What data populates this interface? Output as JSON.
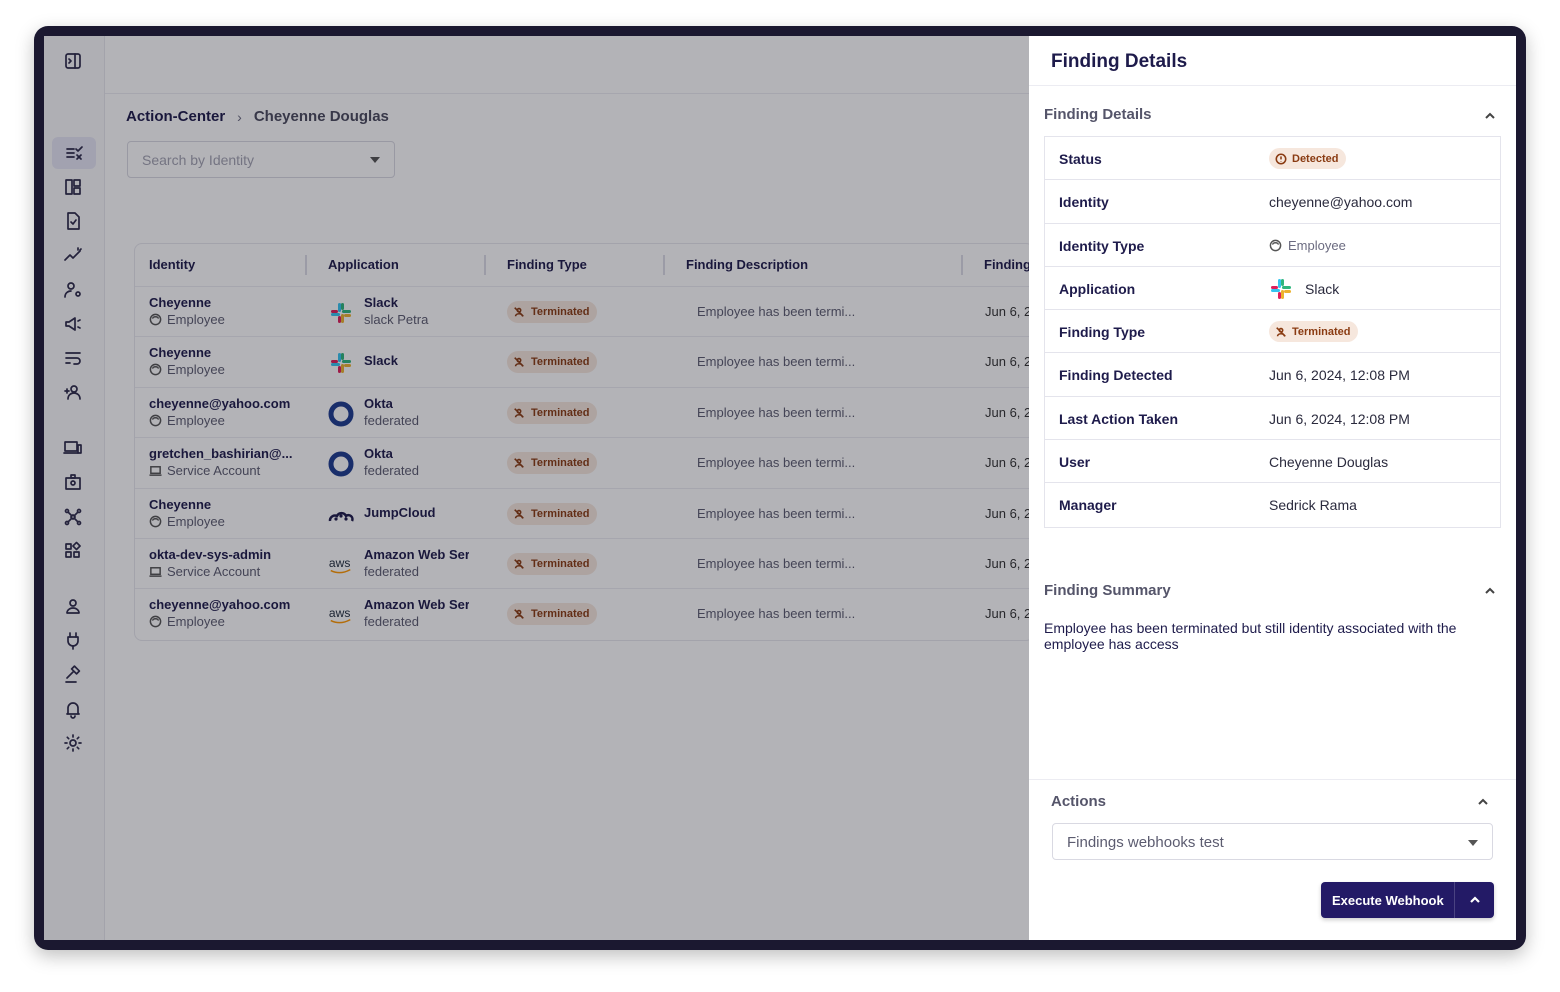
{
  "breadcrumb": {
    "root": "Action-Center",
    "current": "Cheyenne Douglas"
  },
  "search": {
    "placeholder": "Search by Identity"
  },
  "table": {
    "headers": [
      "Identity",
      "Application",
      "Finding Type",
      "Finding Description",
      "Finding"
    ],
    "rows": [
      {
        "identity": "Cheyenne",
        "identity_type": "Employee",
        "app": "Slack",
        "app_sub": "slack Petra",
        "finding_type": "Terminated",
        "description": "Employee has been termi...",
        "date": "Jun 6, 2"
      },
      {
        "identity": "Cheyenne",
        "identity_type": "Employee",
        "app": "Slack",
        "app_sub": "",
        "finding_type": "Terminated",
        "description": "Employee has been termi...",
        "date": "Jun 6, 2"
      },
      {
        "identity": "cheyenne@yahoo.com",
        "identity_type": "Employee",
        "app": "Okta",
        "app_sub": "federated",
        "finding_type": "Terminated",
        "description": "Employee has been termi...",
        "date": "Jun 6, 2"
      },
      {
        "identity": "gretchen_bashirian@...",
        "identity_type": "Service Account",
        "app": "Okta",
        "app_sub": "federated",
        "finding_type": "Terminated",
        "description": "Employee has been termi...",
        "date": "Jun 6, 2"
      },
      {
        "identity": "Cheyenne",
        "identity_type": "Employee",
        "app": "JumpCloud",
        "app_sub": "",
        "finding_type": "Terminated",
        "description": "Employee has been termi...",
        "date": "Jun 6, 2"
      },
      {
        "identity": "okta-dev-sys-admin",
        "identity_type": "Service Account",
        "app": "Amazon Web Ser",
        "app_sub": "federated",
        "finding_type": "Terminated",
        "description": "Employee has been termi...",
        "date": "Jun 6, 2"
      },
      {
        "identity": "cheyenne@yahoo.com",
        "identity_type": "Employee",
        "app": "Amazon Web Ser",
        "app_sub": "federated",
        "finding_type": "Terminated",
        "description": "Employee has been termi...",
        "date": "Jun 6, 2"
      }
    ]
  },
  "drawer": {
    "title": "Finding Details",
    "details_section": "Finding Details",
    "details": {
      "status_label": "Status",
      "status": "Detected",
      "identity_label": "Identity",
      "identity": "cheyenne@yahoo.com",
      "identity_type_label": "Identity Type",
      "identity_type": "Employee",
      "application_label": "Application",
      "application": "Slack",
      "finding_type_label": "Finding Type",
      "finding_type": "Terminated",
      "finding_detected_label": "Finding Detected",
      "finding_detected": "Jun 6, 2024, 12:08 PM",
      "last_action_label": "Last Action Taken",
      "last_action": "Jun 6, 2024, 12:08 PM",
      "user_label": "User",
      "user": "Cheyenne Douglas",
      "manager_label": "Manager",
      "manager": "Sedrick Rama"
    },
    "summary_section": "Finding Summary",
    "summary": "Employee has been terminated but still identity associated with the employee has access",
    "actions_section": "Actions",
    "action_select": "Findings webhooks test",
    "execute_label": "Execute Webhook"
  },
  "aws_logo_text": "aws",
  "colors": {
    "primary": "#231a66",
    "badge_bg": "#f6e7dd",
    "badge_fg": "#8a3b12",
    "frame": "#1b1830"
  }
}
